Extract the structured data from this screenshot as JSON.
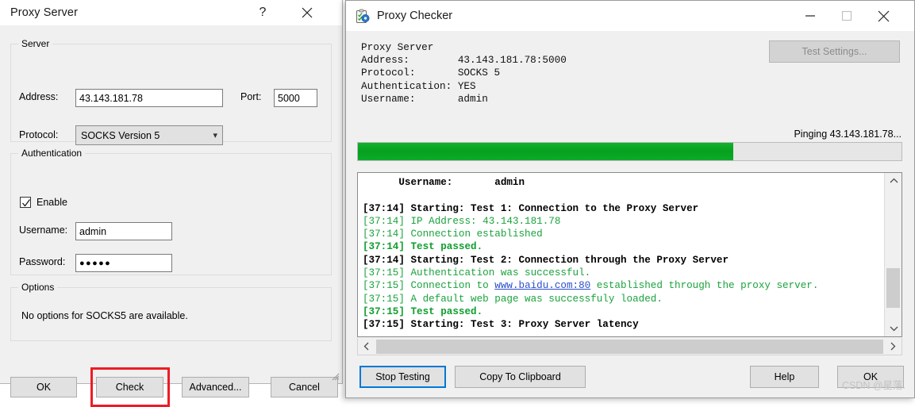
{
  "proxy_server_dialog": {
    "title": "Proxy Server",
    "help_icon": "question-mark-icon",
    "close_icon": "close-icon",
    "server_group": {
      "title": "Server",
      "address_label": "Address:",
      "address_value": "43.143.181.78",
      "port_label": "Port:",
      "port_value": "5000",
      "protocol_label": "Protocol:",
      "protocol_value": "SOCKS Version 5"
    },
    "authentication_group": {
      "title": "Authentication",
      "enable_label": "Enable",
      "enable_checked": true,
      "username_label": "Username:",
      "username_value": "admin",
      "password_label": "Password:",
      "password_value": "●●●●●"
    },
    "options_group": {
      "title": "Options",
      "text": "No options for SOCKS5 are available."
    },
    "buttons": {
      "ok": "OK",
      "check": "Check",
      "advanced": "Advanced...",
      "cancel": "Cancel"
    },
    "highlight_color": "#ee1c24"
  },
  "proxy_checker_window": {
    "title": "Proxy Checker",
    "icon": "clipboard-check-icon",
    "minimize_icon": "minimize-icon",
    "maximize_icon": "maximize-icon",
    "close_icon": "close-icon",
    "info": {
      "heading": "Proxy Server",
      "rows": [
        {
          "label": "Address:",
          "value": "43.143.181.78:5000"
        },
        {
          "label": "Protocol:",
          "value": "SOCKS 5"
        },
        {
          "label": "Authentication:",
          "value": "YES"
        },
        {
          "label": "Username:",
          "value": "admin"
        }
      ],
      "text_block": "Proxy Server\nAddress:        43.143.181.78:5000\nProtocol:       SOCKS 5\nAuthentication: YES\nUsername:       admin"
    },
    "test_settings_button": "Test Settings...",
    "status_text": "Pinging 43.143.181.78...",
    "progress": {
      "percent": 69,
      "fill_color": "#0eac28"
    },
    "log": {
      "top_line": "      Username:       admin",
      "lines": [
        {
          "time": "[37:14]",
          "text": " Starting: Test 1: Connection to the Proxy Server",
          "style": "black-bold"
        },
        {
          "time": "[37:14]",
          "text": " IP Address: 43.143.181.78",
          "style": "green"
        },
        {
          "time": "[37:14]",
          "text": " Connection established",
          "style": "green"
        },
        {
          "time": "[37:14]",
          "text": " Test passed.",
          "style": "green-bold"
        },
        {
          "time": "[37:14]",
          "text": " Starting: Test 2: Connection through the Proxy Server",
          "style": "black-bold"
        },
        {
          "time": "[37:15]",
          "text": " Authentication was successful.",
          "style": "green"
        },
        {
          "time": "[37:15]",
          "text": " Connection to ",
          "link": "www.baidu.com:80",
          "text_after": " established through the proxy server.",
          "style": "green"
        },
        {
          "time": "[37:15]",
          "text": " A default web page was successfuly loaded.",
          "style": "green"
        },
        {
          "time": "[37:15]",
          "text": " Test passed.",
          "style": "green-bold"
        },
        {
          "time": "[37:15]",
          "text": " Starting: Test 3: Proxy Server latency",
          "style": "black-bold"
        }
      ],
      "scroll_up_icon": "chevron-up-icon",
      "scroll_down_icon": "chevron-down-icon",
      "scroll_left_icon": "chevron-left-icon",
      "scroll_right_icon": "chevron-right-icon"
    },
    "buttons": {
      "stop_testing": "Stop Testing",
      "copy_to_clipboard": "Copy To Clipboard",
      "help": "Help",
      "ok": "OK"
    }
  },
  "watermark": "CSDN @星落."
}
